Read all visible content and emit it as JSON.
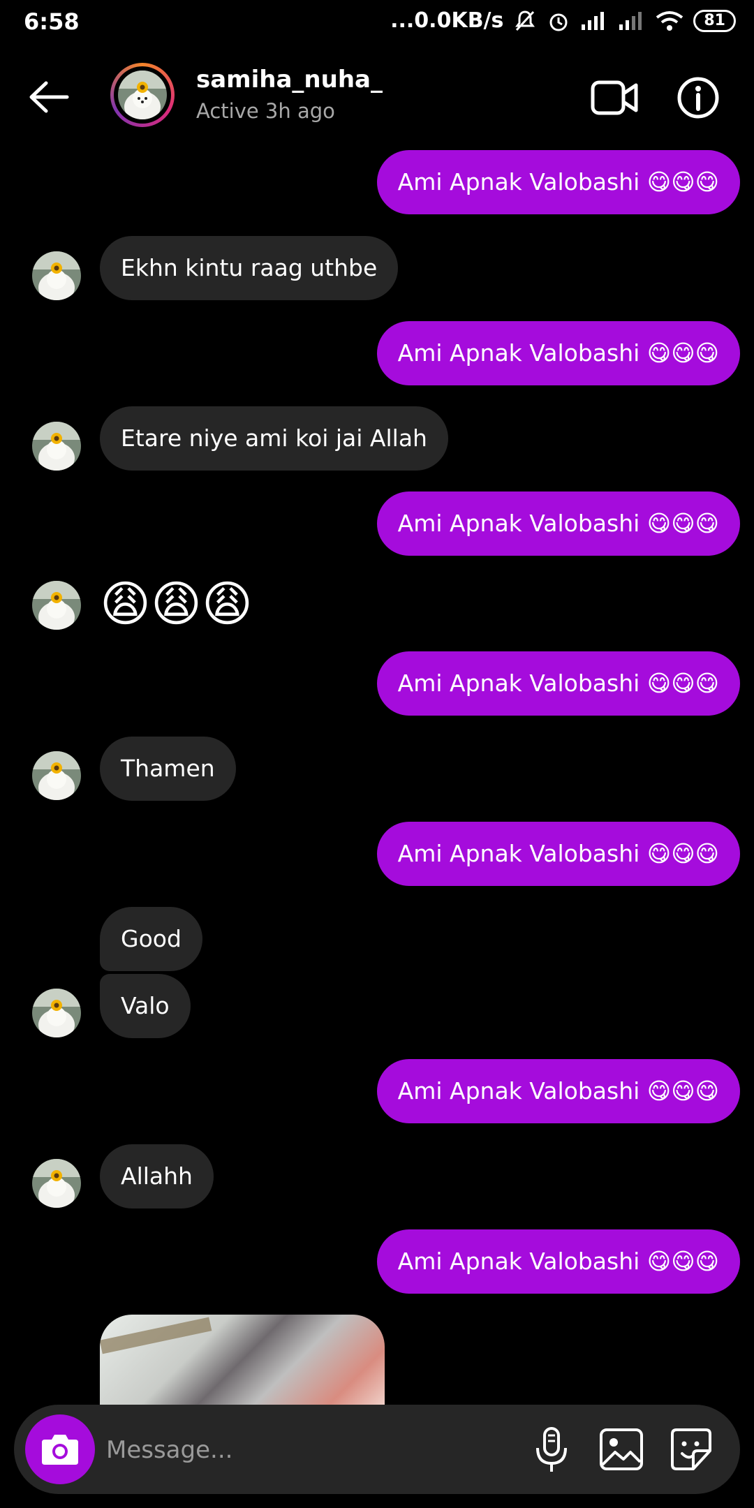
{
  "status_bar": {
    "time": "6:58",
    "network_speed": "0.0KB/s",
    "battery": "81"
  },
  "header": {
    "username": "samiha_nuha_",
    "status": "Active 3h ago"
  },
  "messages": [
    {
      "from": "me",
      "text": "Ami Apnak Valobashi 😋😋😋"
    },
    {
      "from": "them",
      "text": "Ekhn kintu raag uthbe"
    },
    {
      "from": "me",
      "text": "Ami Apnak Valobashi 😋😋😋"
    },
    {
      "from": "them",
      "text": "Etare niye ami koi jai Allah"
    },
    {
      "from": "me",
      "text": "Ami Apnak Valobashi 😋😋😋"
    },
    {
      "from": "them",
      "text": "😩😩😩"
    },
    {
      "from": "me",
      "text": "Ami Apnak Valobashi 😋😋😋"
    },
    {
      "from": "them",
      "text": "Thamen"
    },
    {
      "from": "me",
      "text": "Ami Apnak Valobashi 😋😋😋"
    },
    {
      "from": "them",
      "text": "Good"
    },
    {
      "from": "them",
      "text": "Valo"
    },
    {
      "from": "me",
      "text": "Ami Apnak Valobashi 😋😋😋"
    },
    {
      "from": "them",
      "text": "Allahh"
    },
    {
      "from": "me",
      "text": "Ami Apnak Valobashi 😋😋😋"
    }
  ],
  "composer": {
    "placeholder": "Message..."
  },
  "icons": {
    "back": "arrow-left-icon",
    "video_call": "video-camera-icon",
    "info": "info-icon",
    "camera": "camera-icon",
    "mic": "microphone-icon",
    "gallery": "image-icon",
    "sticker": "sticker-icon"
  },
  "colors": {
    "background": "#000000",
    "outgoing_bubble": "#a50cdc",
    "incoming_bubble": "#262626",
    "secondary_text": "#a8a8a8"
  }
}
